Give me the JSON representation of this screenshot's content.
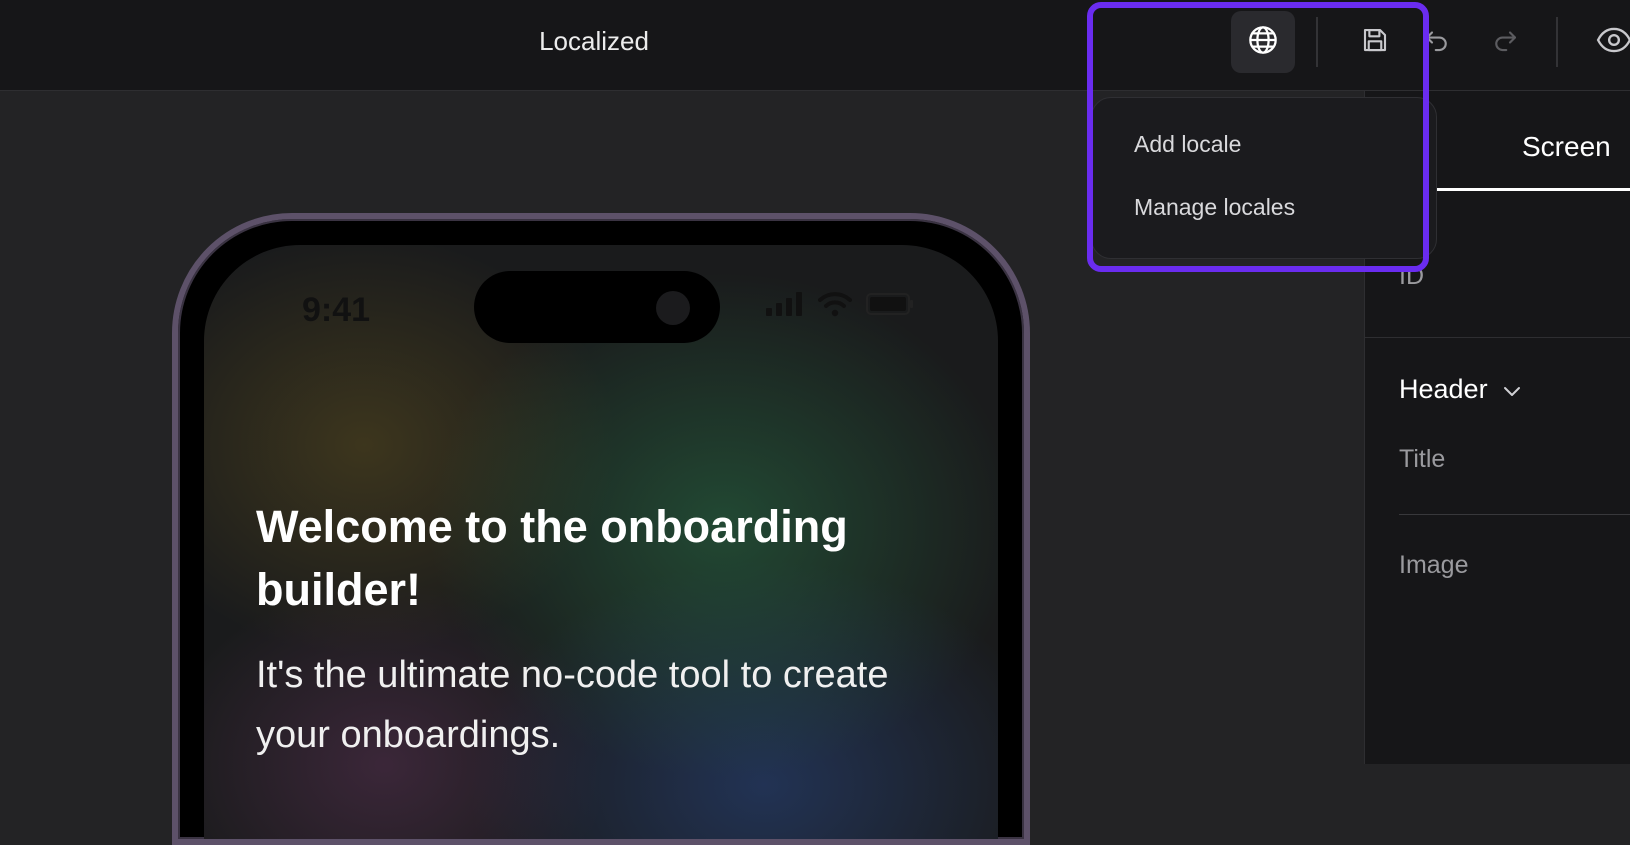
{
  "header": {
    "title": "Localized",
    "icons": {
      "globe": "globe-icon",
      "save": "save-icon",
      "undo": "undo-icon",
      "redo": "redo-icon",
      "preview": "eye-icon"
    }
  },
  "locale_menu": {
    "items": [
      "Add locale",
      "Manage locales"
    ]
  },
  "phone_preview": {
    "status_time": "9:41",
    "headline": "Welcome to the onboarding builder!",
    "subtext": "It's the ultimate no-code tool to create your onboardings."
  },
  "side_panel": {
    "tab": "Screen",
    "id_label": "ID",
    "section": "Header",
    "title_label": "Title",
    "image_label": "Image"
  },
  "colors": {
    "highlight": "#6a2cf0",
    "topbar": "#161618",
    "canvas": "#232325"
  }
}
